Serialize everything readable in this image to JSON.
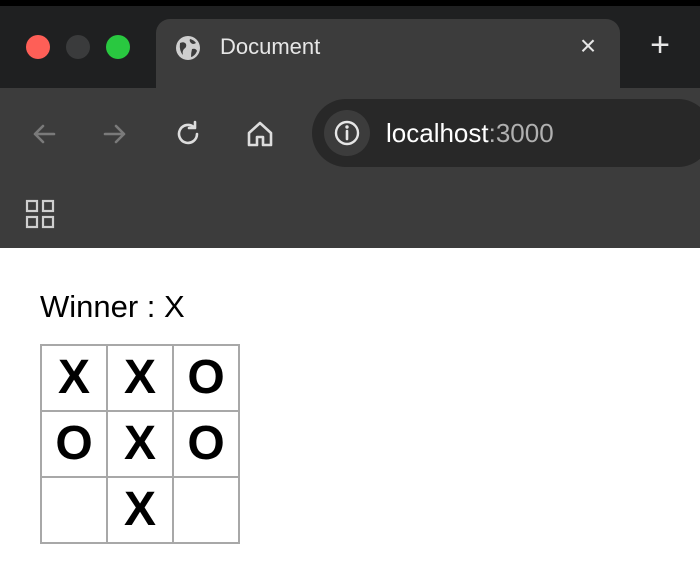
{
  "browser": {
    "tab_title": "Document",
    "url_host": "localhost",
    "url_port": ":3000",
    "close_glyph": "×",
    "new_tab_glyph": "+"
  },
  "game": {
    "status_label": "Winner : X",
    "board": [
      [
        "X",
        "X",
        "O"
      ],
      [
        "O",
        "X",
        "O"
      ],
      [
        "",
        "X",
        ""
      ]
    ]
  }
}
